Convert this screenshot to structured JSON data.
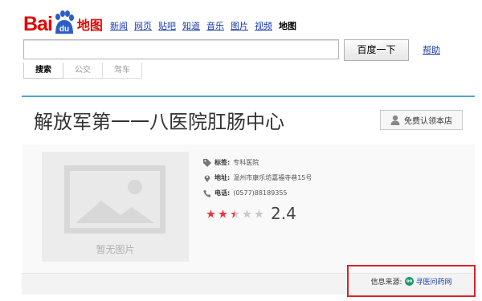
{
  "header": {
    "logo_text": "Bai",
    "logo_du": "du",
    "logo_suffix": "地图",
    "nav": [
      "新闻",
      "网页",
      "贴吧",
      "知道",
      "音乐",
      "图片",
      "视频"
    ],
    "nav_current": "地图",
    "search_value": "",
    "search_button": "百度一下",
    "help_link": "帮助",
    "tabs": [
      "搜索",
      "公交",
      "驾车"
    ]
  },
  "place": {
    "name": "解放军第一一八医院肛肠中心",
    "claim_button": "免费认领本店",
    "no_image": "暂无图片",
    "tag_label": "标签:",
    "tag_value": "专科医院",
    "address_label": "地址:",
    "address_value": "温州市康乐坊嘉福寺巷15号",
    "phone_label": "电话:",
    "phone_value": "(0577)88189355",
    "rating": 2.4,
    "rating_text": "2.4",
    "stars_total": 5
  },
  "source": {
    "label": "信息来源:",
    "link": "寻医问药网"
  },
  "colors": {
    "brand_red": "#e10601",
    "link_blue": "#1b3caa",
    "card_top": "#4ba6d6",
    "star_on": "#e5393e",
    "star_off": "#c8c8c8",
    "highlight_box": "#d9232a"
  },
  "icons": [
    "baidu-paw-icon",
    "user-icon",
    "tag-icon",
    "location-icon",
    "phone-icon",
    "image-placeholder-icon",
    "star-icon",
    "source-site-icon"
  ]
}
